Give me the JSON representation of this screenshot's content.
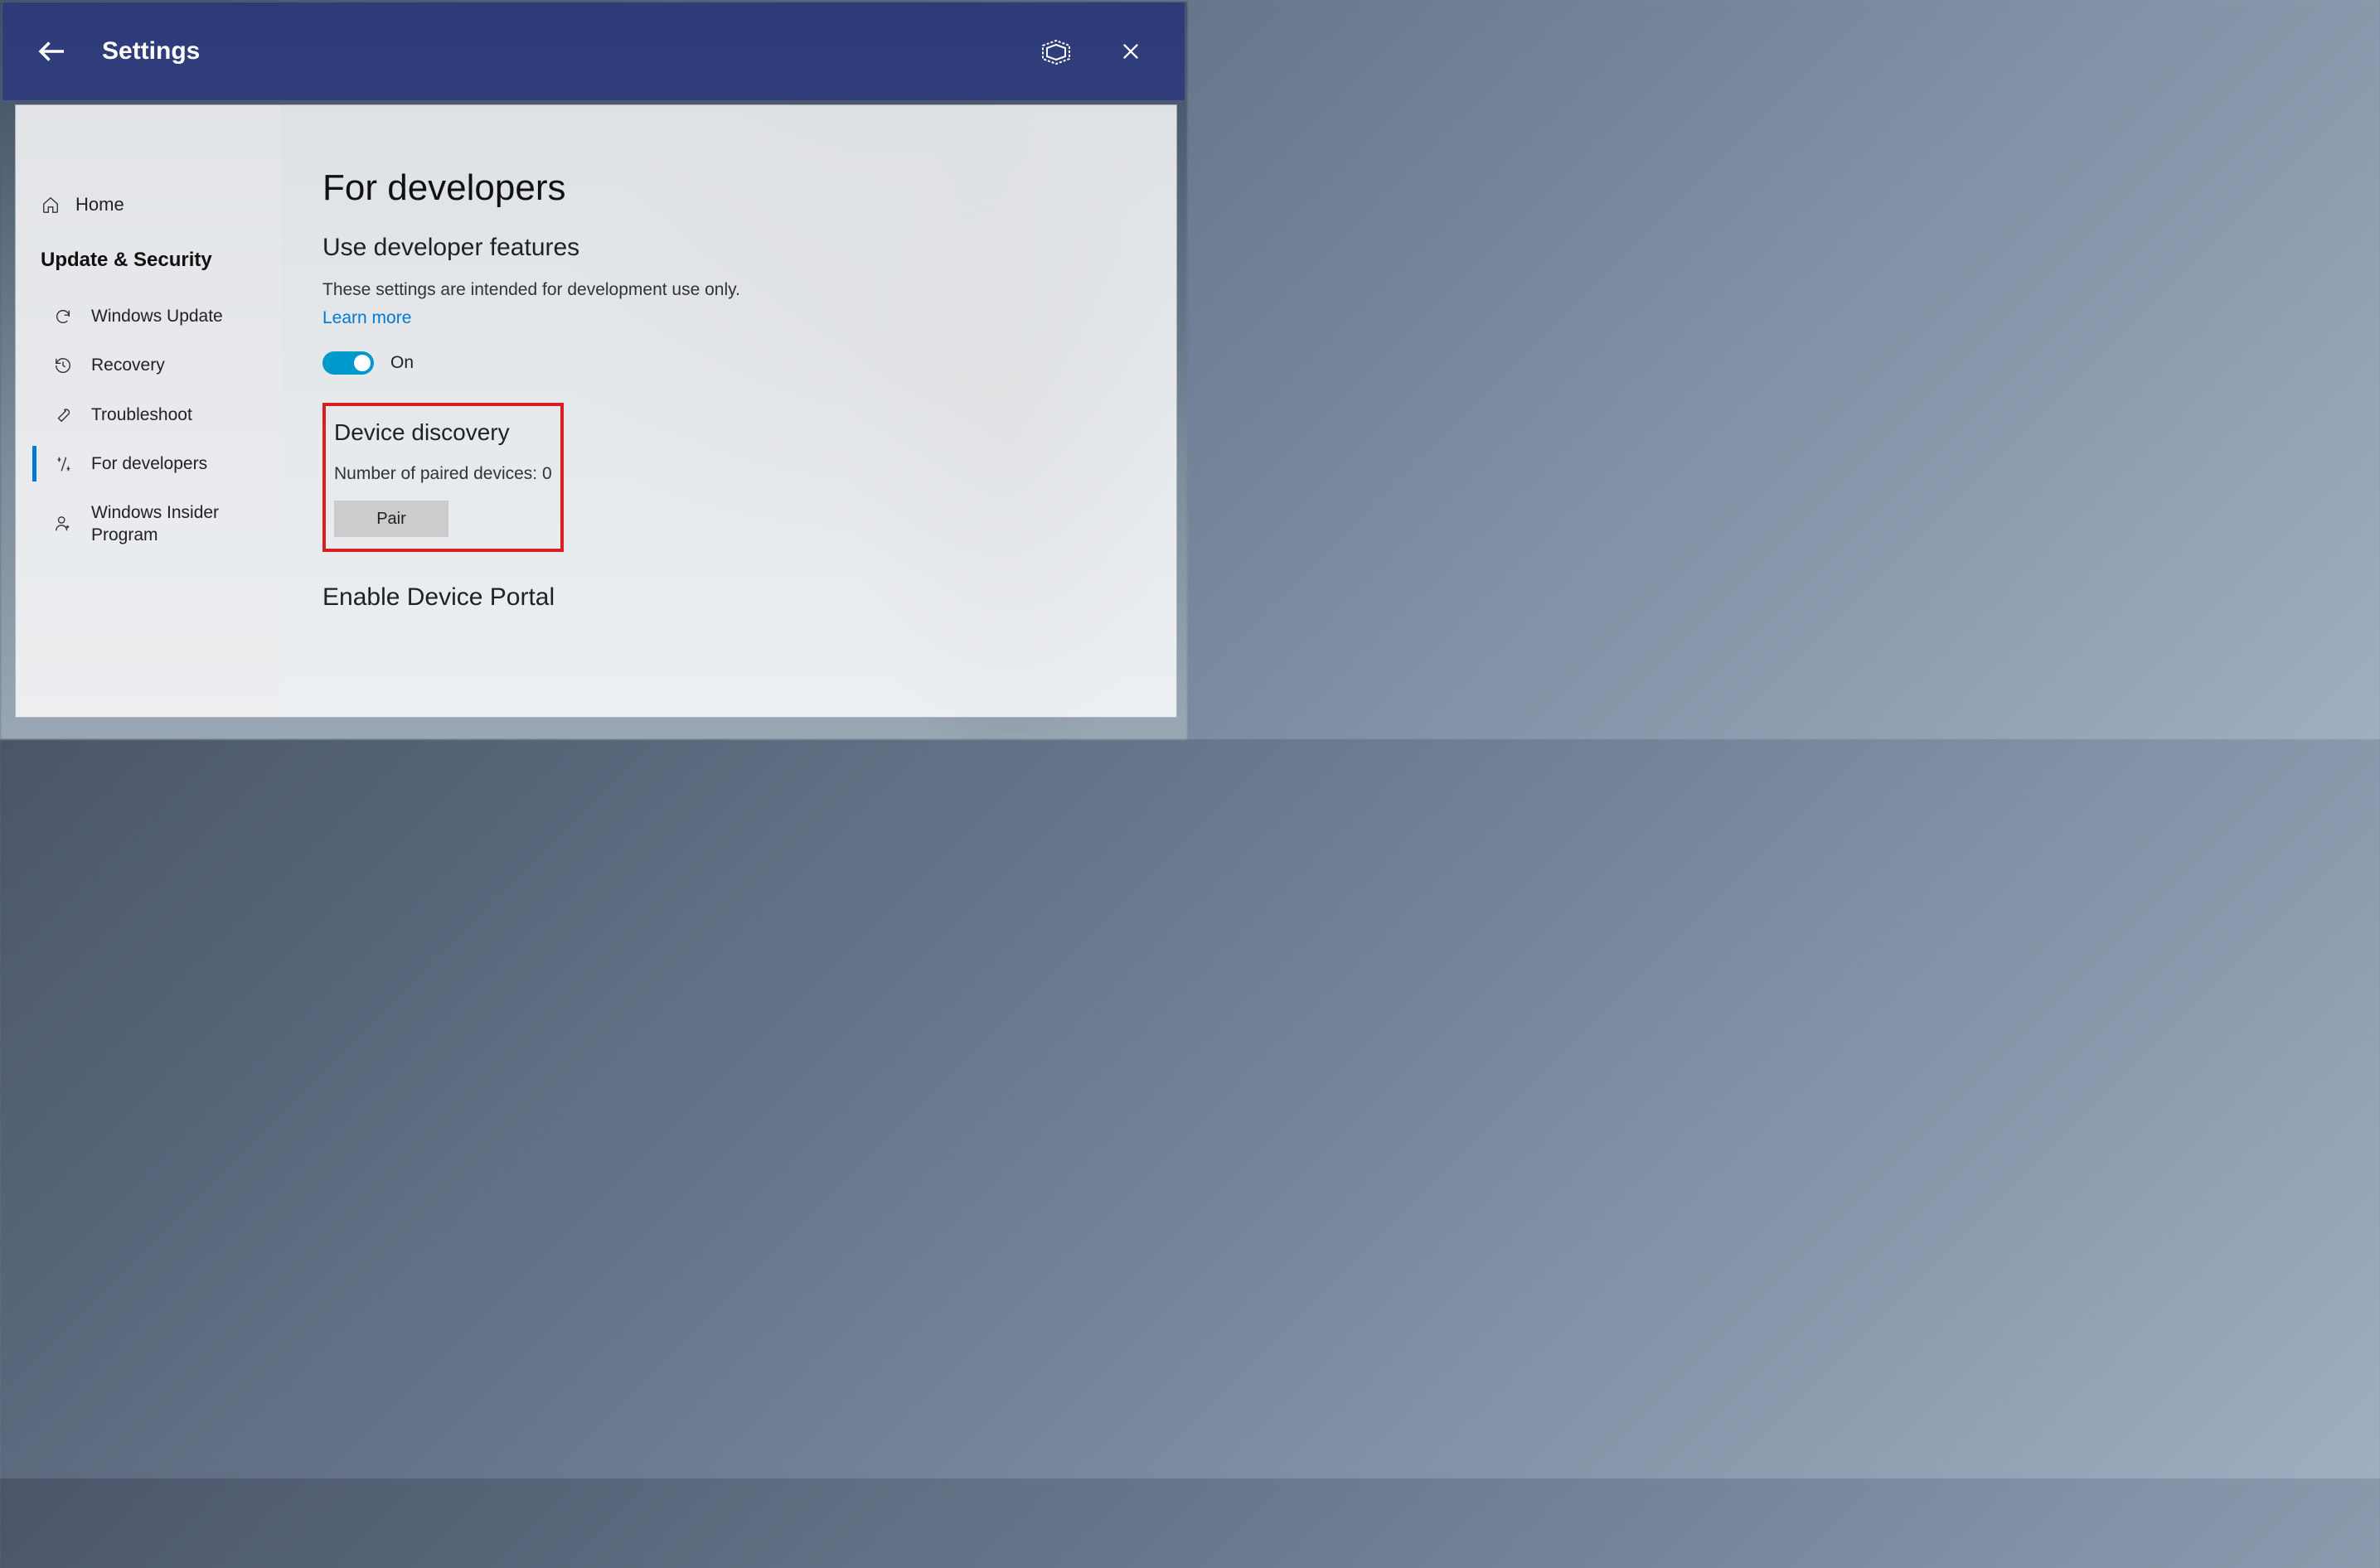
{
  "titlebar": {
    "title": "Settings"
  },
  "sidebar": {
    "home_label": "Home",
    "section_title": "Update & Security",
    "items": [
      {
        "label": "Windows Update"
      },
      {
        "label": "Recovery"
      },
      {
        "label": "Troubleshoot"
      },
      {
        "label": "For developers"
      },
      {
        "label": "Windows Insider Program"
      }
    ]
  },
  "main": {
    "page_title": "For developers",
    "dev_features": {
      "heading": "Use developer features",
      "description": "These settings are intended for development use only.",
      "learn_more": "Learn more",
      "toggle_state": "On"
    },
    "device_discovery": {
      "heading": "Device discovery",
      "paired_label": "Number of paired devices:",
      "paired_count": "0",
      "pair_button": "Pair"
    },
    "device_portal": {
      "heading": "Enable Device Portal"
    }
  }
}
